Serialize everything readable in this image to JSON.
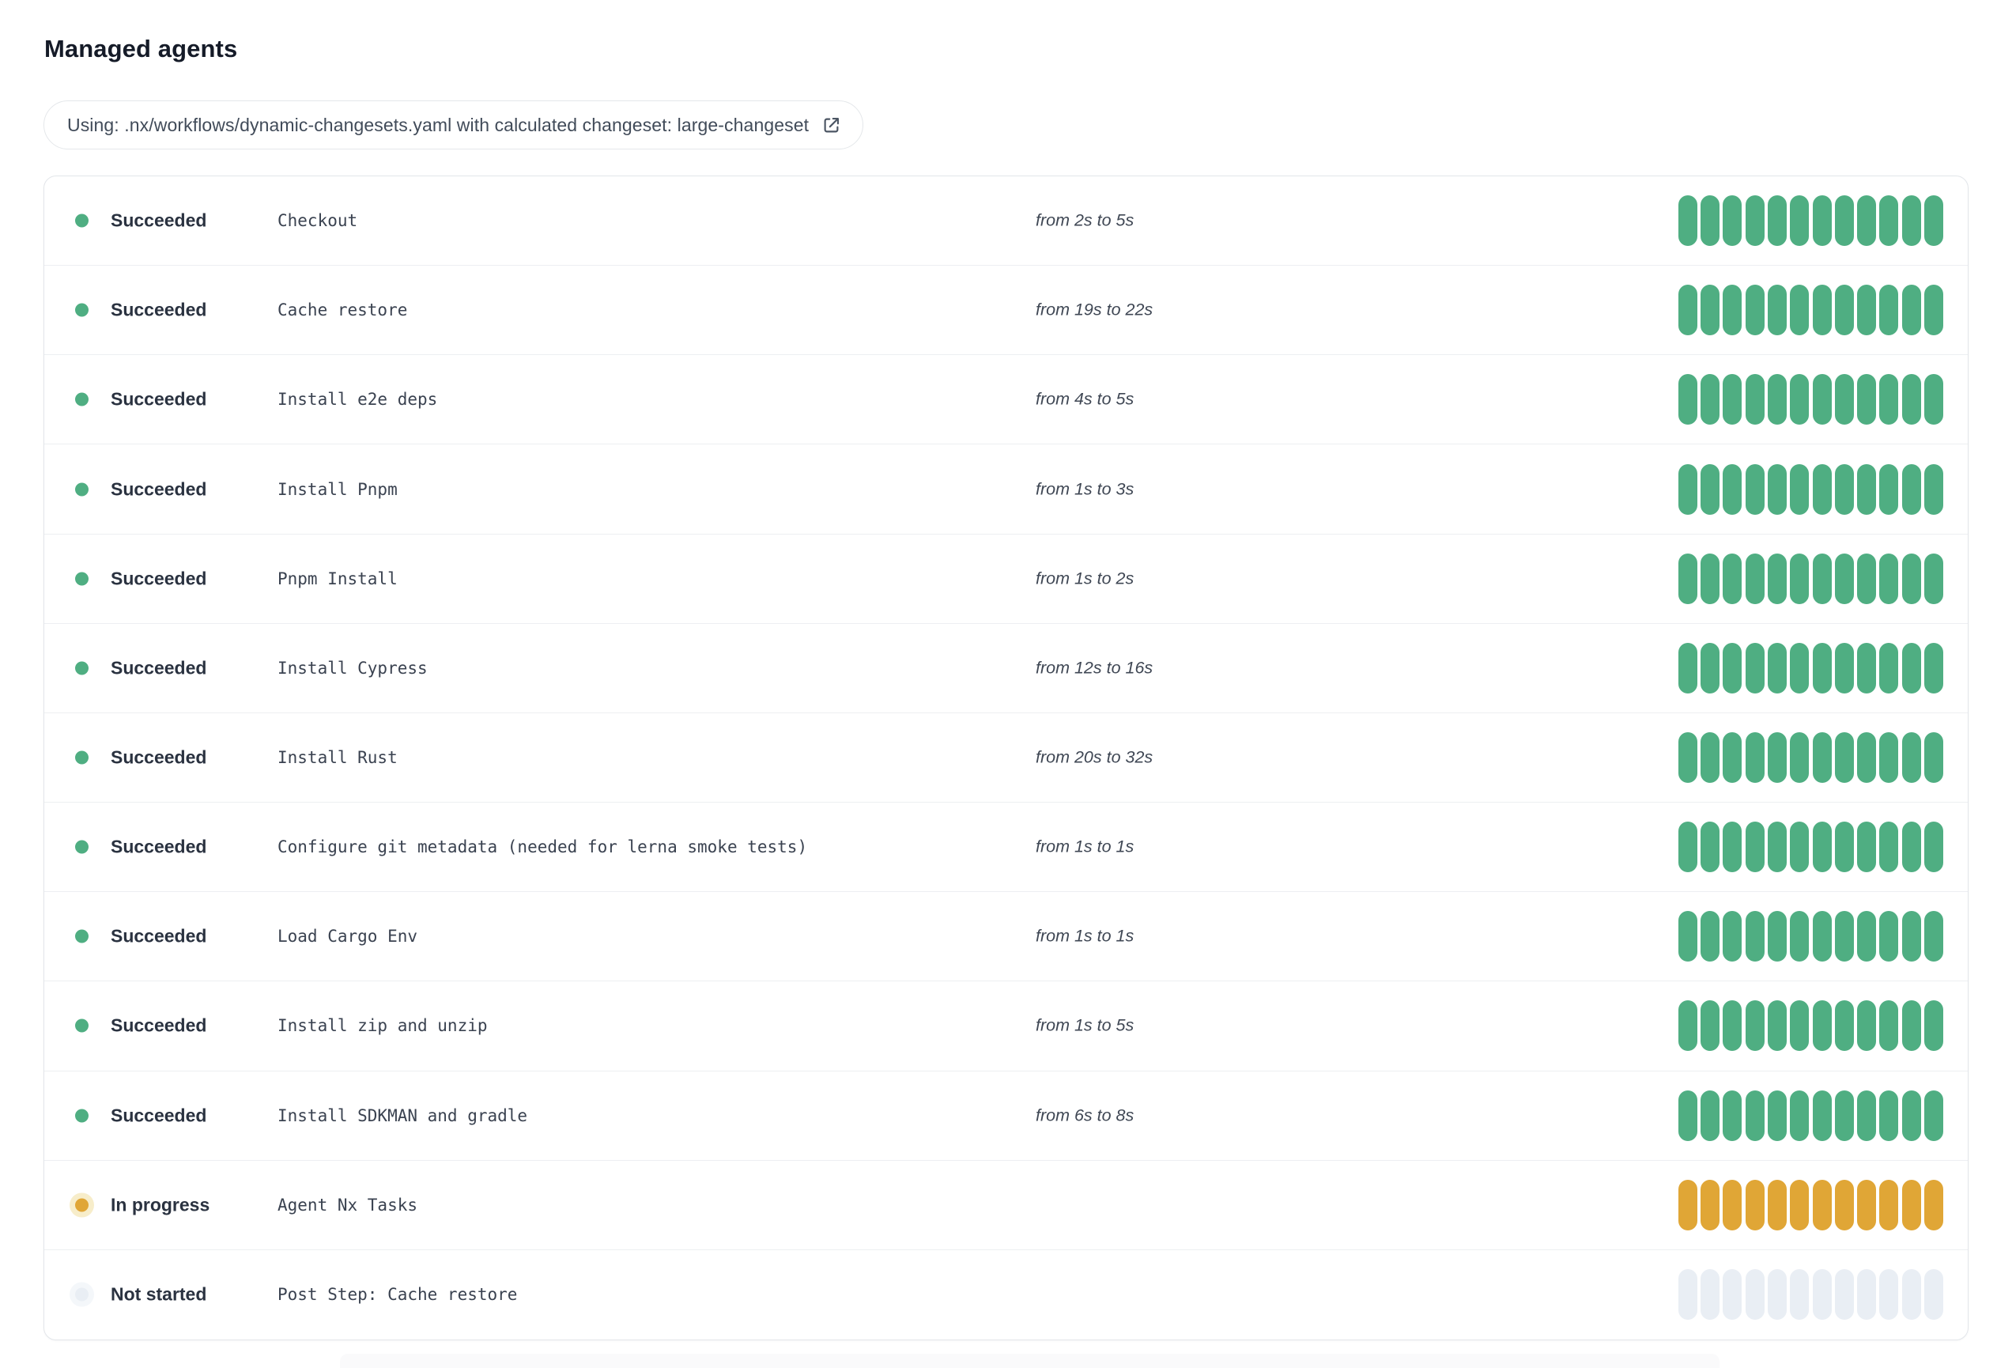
{
  "page": {
    "title": "Managed agents"
  },
  "banner": {
    "label": "Using: .nx/workflows/dynamic-changesets.yaml with calculated changeset: large-changeset",
    "icon": "external-link"
  },
  "agents_card": {
    "bar_segments_per_row": 12,
    "statuses": {
      "succeeded": {
        "label": "Succeeded",
        "color": "#4fae82",
        "halo": "transparent"
      },
      "in_progress": {
        "label": "In progress",
        "color": "#e0a636",
        "halo": "#f7edca"
      },
      "not_started": {
        "label": "Not started",
        "color": "#e9eef4",
        "halo": "#f4f7fa"
      }
    },
    "rows": [
      {
        "status": "succeeded",
        "status_label": "Succeeded",
        "step": "Checkout",
        "duration": "from 2s to 5s"
      },
      {
        "status": "succeeded",
        "status_label": "Succeeded",
        "step": "Cache restore",
        "duration": "from 19s to 22s"
      },
      {
        "status": "succeeded",
        "status_label": "Succeeded",
        "step": "Install e2e deps",
        "duration": "from 4s to 5s"
      },
      {
        "status": "succeeded",
        "status_label": "Succeeded",
        "step": "Install Pnpm",
        "duration": "from 1s to 3s"
      },
      {
        "status": "succeeded",
        "status_label": "Succeeded",
        "step": "Pnpm Install",
        "duration": "from 1s to 2s"
      },
      {
        "status": "succeeded",
        "status_label": "Succeeded",
        "step": "Install Cypress",
        "duration": "from 12s to 16s"
      },
      {
        "status": "succeeded",
        "status_label": "Succeeded",
        "step": "Install Rust",
        "duration": "from 20s to 32s"
      },
      {
        "status": "succeeded",
        "status_label": "Succeeded",
        "step": "Configure git metadata (needed for lerna smoke tests)",
        "duration": "from 1s to 1s"
      },
      {
        "status": "succeeded",
        "status_label": "Succeeded",
        "step": "Load Cargo Env",
        "duration": "from 1s to 1s"
      },
      {
        "status": "succeeded",
        "status_label": "Succeeded",
        "step": "Install zip and unzip",
        "duration": "from 1s to 5s"
      },
      {
        "status": "succeeded",
        "status_label": "Succeeded",
        "step": "Install SDKMAN and gradle",
        "duration": "from 6s to 8s"
      },
      {
        "status": "in_progress",
        "status_label": "In progress",
        "step": "Agent Nx Tasks",
        "duration": ""
      },
      {
        "status": "not_started",
        "status_label": "Not started",
        "step": "Post Step: Cache restore",
        "duration": ""
      }
    ]
  },
  "colors": {
    "title_text": "#151b28",
    "status_text": "#2a3240",
    "step_text": "#3a4250",
    "banner_text": "#414b59",
    "card_border": "#e3e6ea",
    "row_divider": "#edeff2",
    "succeeded_green": "#4fae82",
    "in_progress_amber": "#e0a636",
    "not_started_gray": "#e9eef4"
  }
}
